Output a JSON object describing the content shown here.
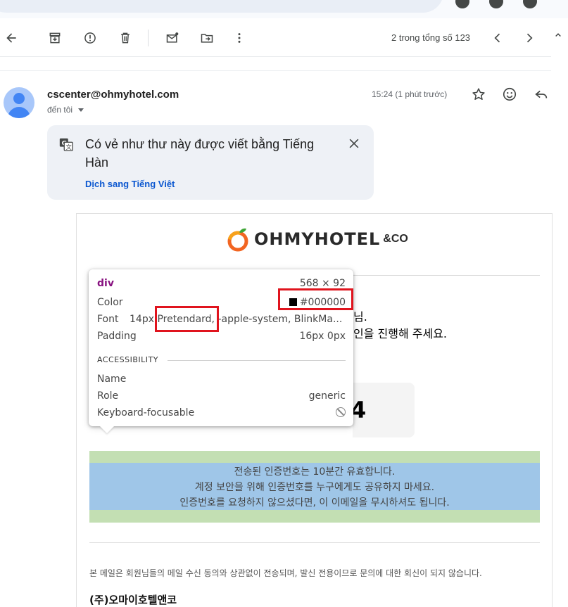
{
  "toolbar": {
    "back": "back",
    "archive": "archive",
    "spam": "report spam",
    "delete": "delete",
    "unread": "mark unread",
    "move": "move to",
    "more": "more",
    "pager_text": "2 trong tổng số 123"
  },
  "message": {
    "sender": "cscenter@ohmyhotel.com",
    "recipient": "đến tôi",
    "timestamp": "15:24 (1 phút trước)"
  },
  "translate_banner": {
    "text": "Có vẻ như thư này được viết bằng Tiếng Hàn",
    "link": "Dịch sang Tiếng Việt"
  },
  "email": {
    "logo_text": "OHMYHOTEL",
    "logo_amp": "&CO",
    "line1_tail": "님.",
    "line2_tail": "인을 진행해 주세요.",
    "code_visible_digit": "4",
    "notice_lines": [
      "전송된 인증번호는 10분간 유효합니다.",
      "계정 보안을 위해 인증번호를 누구에게도 공유하지 마세요.",
      "인증번호를 요청하지 않으셨다면, 이 이메일을 무시하셔도 됩니다."
    ],
    "footer_note": "본 메일은 회원님들의 메일 수신 동의와 상관없이 전송되며, 발신 전용이므로 문의에 대한 회신이 되지 않습니다.",
    "company": "(주)오마이호텔앤코"
  },
  "inspector": {
    "tag": "div",
    "size": "568 × 92",
    "color_label": "Color",
    "color_value": "#000000",
    "font_label": "Font",
    "font_size": "14px",
    "font_family": "Pretendard, -apple-system, BlinkMa...",
    "padding_label": "Padding",
    "padding_value": "16px 0px",
    "accessibility_label": "ACCESSIBILITY",
    "name_label": "Name",
    "role_label": "Role",
    "role_value": "generic",
    "focus_label": "Keyboard-focusable"
  },
  "colors": {
    "accent_link": "#0b57d0",
    "highlight_red": "#e0141e",
    "notice_padding": "#c3dfb3",
    "notice_content": "#9fc6e8",
    "logo_orange": "#f26522"
  }
}
